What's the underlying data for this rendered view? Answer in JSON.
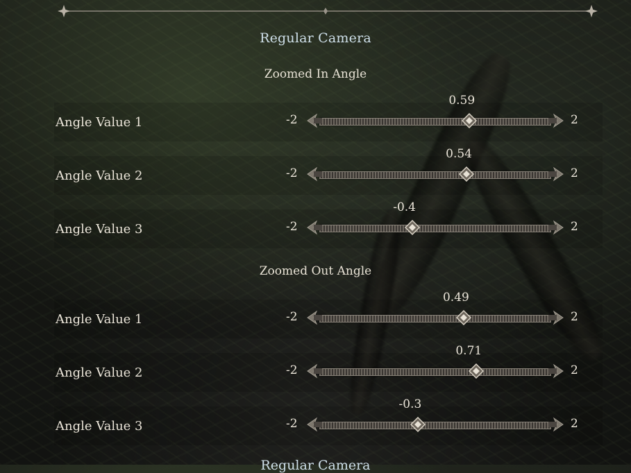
{
  "section": {
    "title": "Regular Camera",
    "next_title_partial": "Regular Camera"
  },
  "groups": [
    {
      "title": "Zoomed In Angle",
      "rows": [
        {
          "label": "Angle Value 1",
          "min": "-2",
          "max": "2",
          "value": "0.59",
          "num": 0.59
        },
        {
          "label": "Angle Value 2",
          "min": "-2",
          "max": "2",
          "value": "0.54",
          "num": 0.54
        },
        {
          "label": "Angle Value 3",
          "min": "-2",
          "max": "2",
          "value": "-0.4",
          "num": -0.4
        }
      ]
    },
    {
      "title": "Zoomed Out Angle",
      "rows": [
        {
          "label": "Angle Value 1",
          "min": "-2",
          "max": "2",
          "value": "0.49",
          "num": 0.49
        },
        {
          "label": "Angle Value 2",
          "min": "-2",
          "max": "2",
          "value": "0.71",
          "num": 0.71
        },
        {
          "label": "Angle Value 3",
          "min": "-2",
          "max": "2",
          "value": "-0.3",
          "num": -0.3
        }
      ]
    }
  ],
  "slider_range": {
    "min": -2,
    "max": 2
  },
  "colors": {
    "title": "#cfe0ea",
    "text": "#ece6da",
    "ornament": "#9a948a"
  }
}
